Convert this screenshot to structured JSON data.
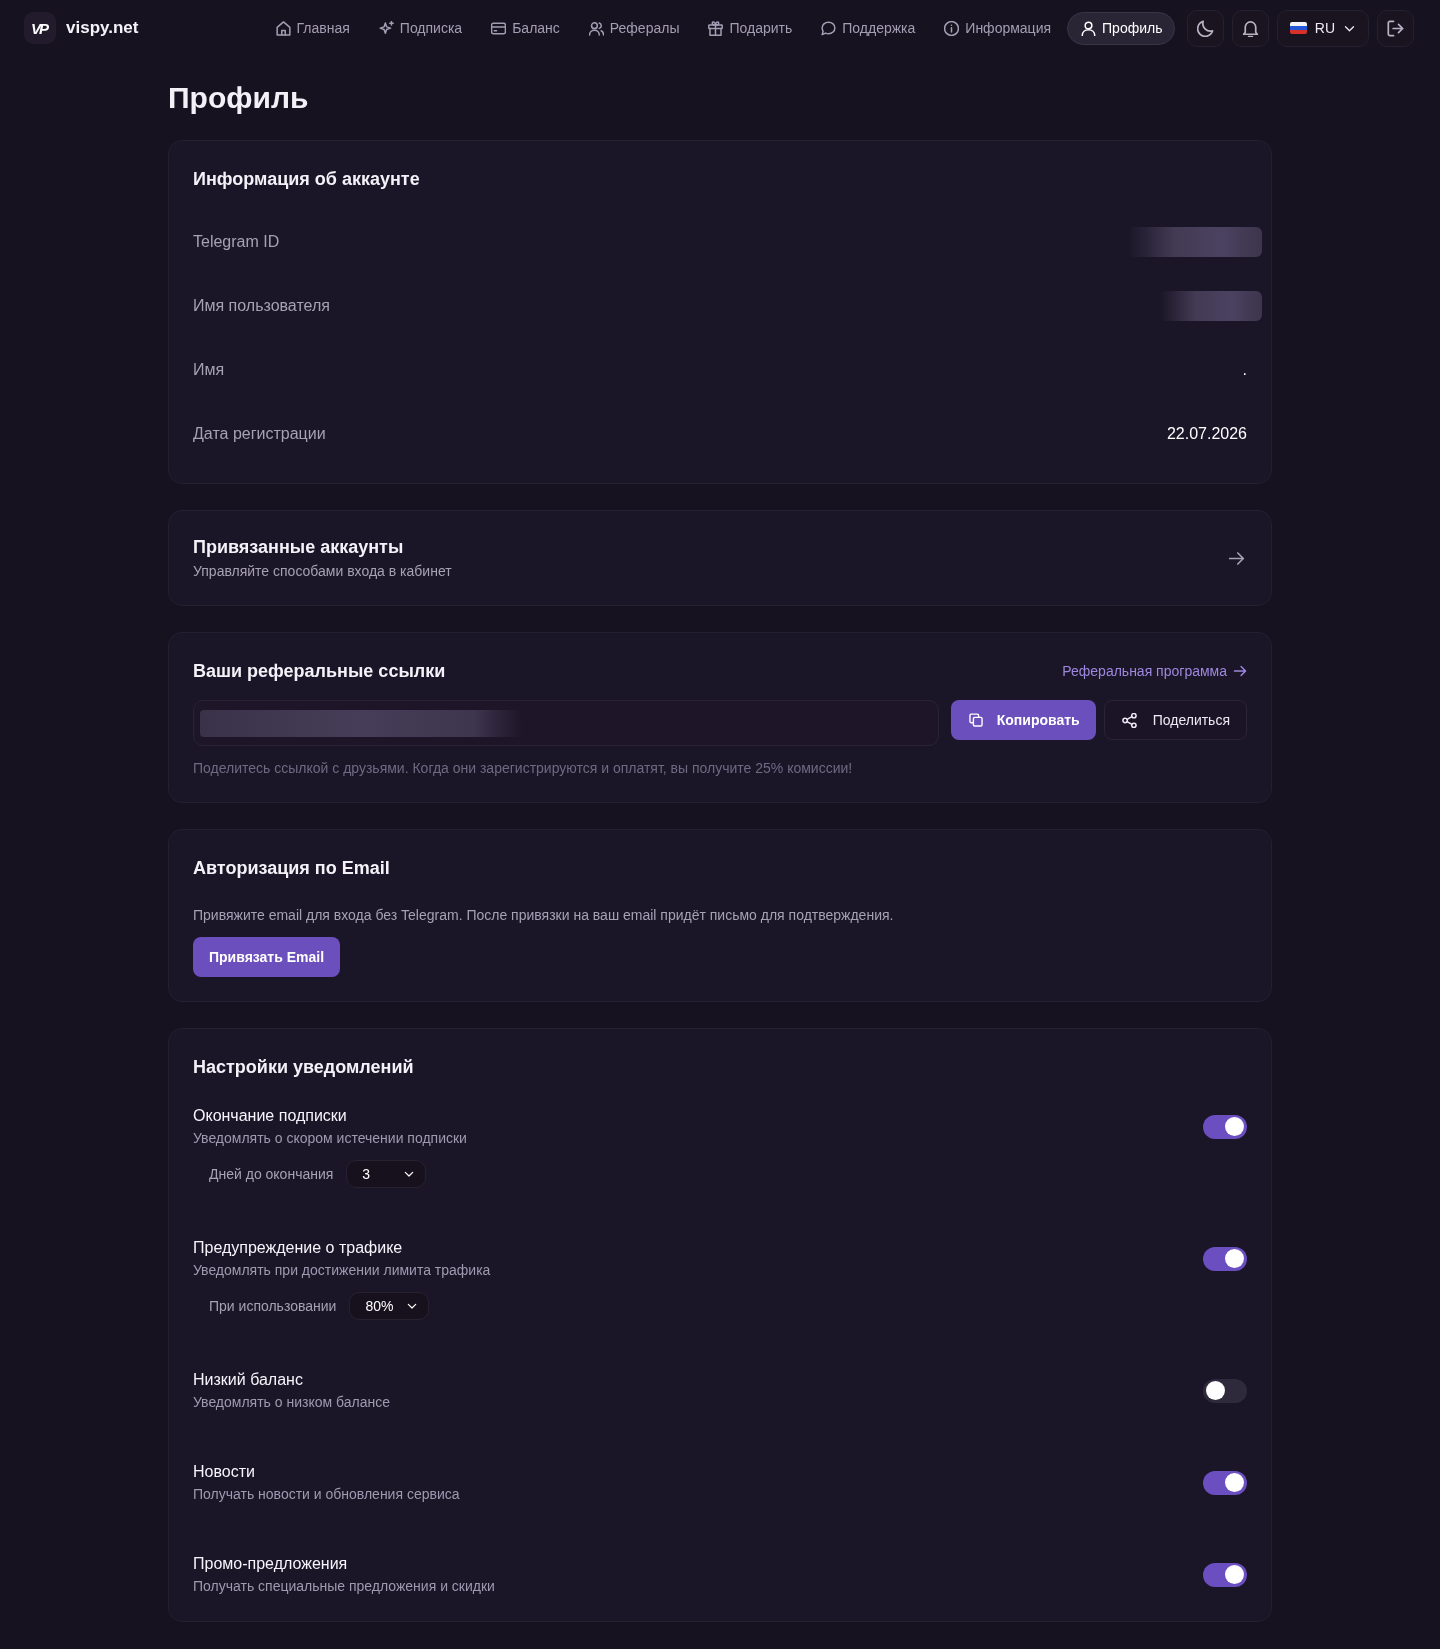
{
  "header": {
    "logo_mark": "VP",
    "logo_text": "vispy.net",
    "nav": [
      {
        "label": "Главная",
        "selected": false
      },
      {
        "label": "Подписка",
        "selected": false
      },
      {
        "label": "Баланс",
        "selected": false
      },
      {
        "label": "Рефералы",
        "selected": false
      },
      {
        "label": "Подарить",
        "selected": false
      },
      {
        "label": "Поддержка",
        "selected": false
      },
      {
        "label": "Информация",
        "selected": false
      },
      {
        "label": "Профиль",
        "selected": true
      }
    ],
    "language": "RU"
  },
  "page_title": "Профиль",
  "account_info": {
    "title": "Информация об аккаунте",
    "rows": [
      {
        "label": "Telegram ID",
        "kind": "redacted"
      },
      {
        "label": "Имя пользователя",
        "kind": "redacted"
      },
      {
        "label": "Имя",
        "kind": "text",
        "value": "."
      },
      {
        "label": "Дата регистрации",
        "kind": "text",
        "value": "22.07.2026"
      }
    ]
  },
  "linked_accounts": {
    "title": "Привязанные аккаунты",
    "subtitle": "Управляйте способами входа в кабинет"
  },
  "referral": {
    "title": "Ваши реферальные ссылки",
    "program_link": "Реферальная программа",
    "copy_button": "Копировать",
    "share_button": "Поделиться",
    "hint": "Поделитесь ссылкой с друзьями. Когда они зарегистрируются и оплатят, вы получите 25% комиссии!"
  },
  "email_auth": {
    "title": "Авторизация по Email",
    "description": "Привяжите email для входа без Telegram. После привязки на ваш email придёт письмо для подтверждения.",
    "button": "Привязать Email"
  },
  "notifications": {
    "title": "Настройки уведомлений",
    "items": [
      {
        "title": "Окончание подписки",
        "description": "Уведомлять о скором истечении подписки",
        "on": true,
        "setting": {
          "label": "Дней до окончания",
          "value": "3"
        }
      },
      {
        "title": "Предупреждение о трафике",
        "description": "Уведомлять при достижении лимита трафика",
        "on": true,
        "setting": {
          "label": "При использовании",
          "value": "80%"
        }
      },
      {
        "title": "Низкий баланс",
        "description": "Уведомлять о низком балансе",
        "on": false
      },
      {
        "title": "Новости",
        "description": "Получать новости и обновления сервиса",
        "on": true
      },
      {
        "title": "Промо-предложения",
        "description": "Получать специальные предложения и скидки",
        "on": true
      }
    ]
  }
}
